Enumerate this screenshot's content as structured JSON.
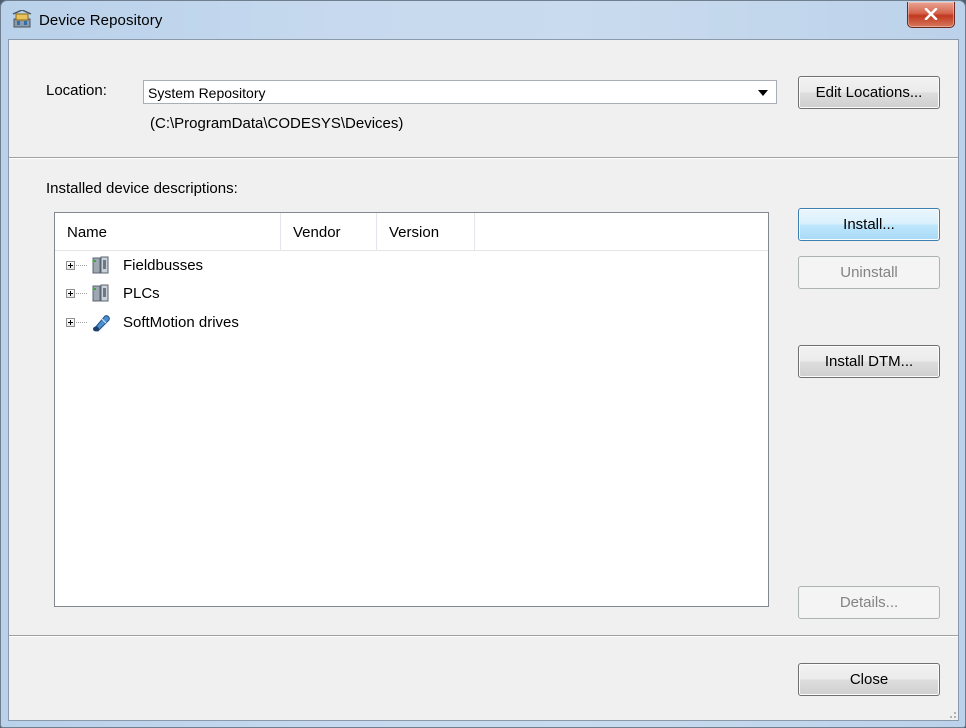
{
  "window": {
    "title": "Device Repository",
    "close_label": "Close window"
  },
  "location": {
    "label": "Location:",
    "selected": "System Repository",
    "path": "(C:\\ProgramData\\CODESYS\\Devices)",
    "edit_button": "Edit Locations..."
  },
  "installed": {
    "label": "Installed device descriptions:",
    "columns": [
      "Name",
      "Vendor",
      "Version"
    ],
    "items": [
      {
        "label": "Fieldbusses",
        "icon": "device-module-icon"
      },
      {
        "label": "PLCs",
        "icon": "device-module-icon"
      },
      {
        "label": "SoftMotion drives",
        "icon": "motion-drive-icon"
      }
    ]
  },
  "buttons": {
    "install": "Install...",
    "uninstall": "Uninstall",
    "install_dtm": "Install DTM...",
    "details": "Details...",
    "close": "Close"
  },
  "colors": {
    "focus_border": "#3c7fb1",
    "close_red": "#c0391f"
  }
}
